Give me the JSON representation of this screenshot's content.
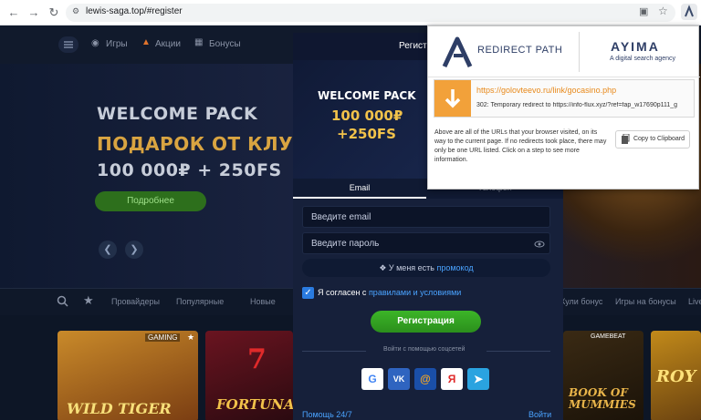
{
  "browser": {
    "url": "lewis-saga.top/#register"
  },
  "site": {
    "nav": [
      "Игры",
      "Акции",
      "Бонусы"
    ],
    "hero": {
      "line1": "WELCOME PACK",
      "line2": "ПОДАРОК ОТ КЛУ",
      "line3": "100 000₽ + 250FS",
      "button": "Подробнее"
    },
    "categories": [
      "Провайдеры",
      "Популярные",
      "Новые"
    ],
    "categories_right": [
      "Кули бонус",
      "Игры на бонусы",
      "Live"
    ],
    "games": {
      "g1_badge": "GAMING",
      "g1_title": "WILD TIGER",
      "g2_title": "FORTUNA",
      "g3_badge": "GAMEBEAT",
      "g3_title": "BOOK OF MUMMIES",
      "g4_title": "ROY"
    }
  },
  "modal": {
    "title": "Регистрация",
    "promo_line1": "WELCOME PACK",
    "promo_line2": "100 000₽",
    "promo_line3": "+250FS",
    "tab_email": "Email",
    "tab_phone": "Телефон",
    "email_placeholder": "Введите email",
    "password_placeholder": "Введите пароль",
    "promo_text": "У меня есть ",
    "promo_link": "промокод",
    "agree_text": "Я согласен с ",
    "agree_link": "правилами и условиями",
    "register_button": "Регистрация",
    "social_label": "Войти с помощью соцсетей",
    "help": "Помощь 24/7",
    "login": "Войти"
  },
  "extension": {
    "brand": "REDIRECT PATH",
    "agency_name": "AYIMA",
    "agency_tagline": "A digital search agency",
    "redirect_url": "https://golovteevo.ru/link/gocasino.php",
    "redirect_status": "302: Temporary redirect to https://info-flux.xyz/?ref=fap_w17690p111_g",
    "info_text": "Above are all of the URLs that your browser visited, on its way to the current page. If no redirects took place, there may only be one URL listed. Click on a step to see more information.",
    "copy_button": "Copy to Clipboard"
  },
  "colors": {
    "accent_orange": "#f2a13a",
    "redirect_url": "#e8891a",
    "register_green": "#35a823",
    "link_blue": "#4aa3ff",
    "hero_gold": "#d9a441"
  }
}
